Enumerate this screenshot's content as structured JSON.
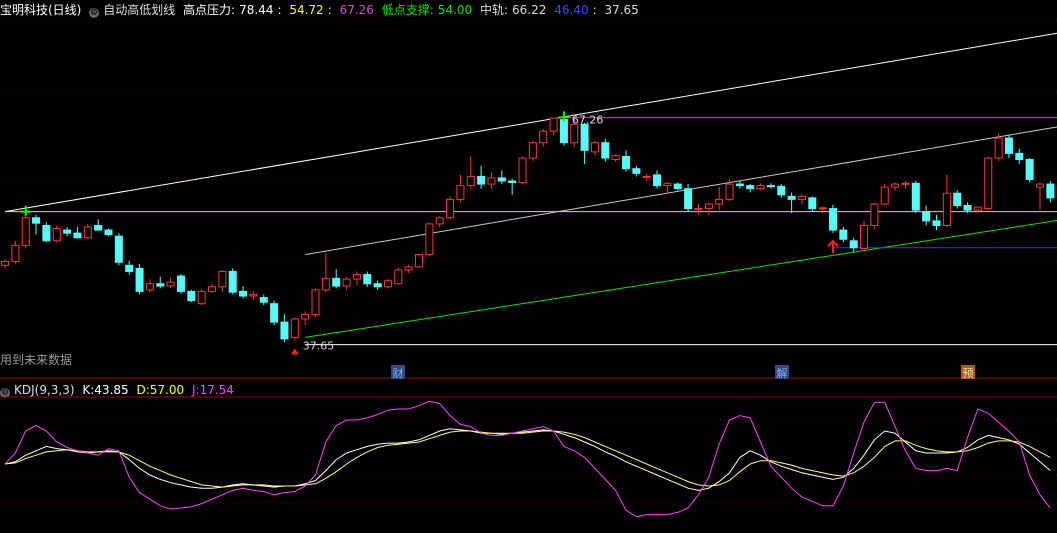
{
  "header": {
    "stock": "宝明科技(日线)",
    "indicator": "自动高低划线",
    "high_label": "高点压力:",
    "high_vals": [
      "78.44",
      "54.72"
    ],
    "high_val3": "67.26",
    "low_label": "低点支撑:",
    "low_val": "54.00",
    "mid_label": "中轨:",
    "mid_val": "66.22",
    "blue_val": "46.40",
    "last_val": "37.65",
    "future_note": "用到未来数据"
  },
  "kdj": {
    "name": "KDJ(9,3,3)",
    "k_label": "K:",
    "k_val": "43.85",
    "d_label": "D:",
    "d_val": "57.00",
    "j_label": "J:",
    "j_val": "17.54"
  },
  "events": [
    "财",
    "解",
    "预"
  ],
  "colors": {
    "up": "#ff3232",
    "down": "#54fcfc",
    "upper": "#ffffff",
    "middle": "#c8c8c8",
    "support": "#00e600",
    "resistance": "#e0e040",
    "purple": "#c040c0",
    "blue": "#2040ff",
    "k": "#ffffff",
    "d": "#ffff60",
    "j": "#ff40ff"
  },
  "chart_data": [
    {
      "type": "candlestick",
      "ylim": [
        35,
        80
      ],
      "price_labels": [
        "67.26",
        "37.65"
      ],
      "candles": [
        [
          48.0,
          48.8,
          47.6,
          48.5
        ],
        [
          48.5,
          51.2,
          48.2,
          50.6
        ],
        [
          50.6,
          55.0,
          50.2,
          54.2
        ],
        [
          54.2,
          54.6,
          52.0,
          53.5
        ],
        [
          53.2,
          53.6,
          51.0,
          51.2
        ],
        [
          51.2,
          53.2,
          51.0,
          52.8
        ],
        [
          52.6,
          53.0,
          51.8,
          52.2
        ],
        [
          52.2,
          53.0,
          51.5,
          51.6
        ],
        [
          51.6,
          53.4,
          51.4,
          53.0
        ],
        [
          53.2,
          54.0,
          52.6,
          52.6
        ],
        [
          52.6,
          52.8,
          51.8,
          52.0
        ],
        [
          51.8,
          52.2,
          48.0,
          48.4
        ],
        [
          48.0,
          48.6,
          46.8,
          47.2
        ],
        [
          47.6,
          48.2,
          44.2,
          44.6
        ],
        [
          44.8,
          46.2,
          44.5,
          45.6
        ],
        [
          45.6,
          46.5,
          45.0,
          45.3
        ],
        [
          45.3,
          46.4,
          45.0,
          45.8
        ],
        [
          46.6,
          46.9,
          44.3,
          44.6
        ],
        [
          44.6,
          44.8,
          43.2,
          43.4
        ],
        [
          43.0,
          44.9,
          42.8,
          44.6
        ],
        [
          44.6,
          45.6,
          44.4,
          45.2
        ],
        [
          45.2,
          47.4,
          44.5,
          47.2
        ],
        [
          47.2,
          47.6,
          44.2,
          44.5
        ],
        [
          44.6,
          45.3,
          43.7,
          44.0
        ],
        [
          44.0,
          44.6,
          43.5,
          44.2
        ],
        [
          43.8,
          44.2,
          42.8,
          43.2
        ],
        [
          43.0,
          43.4,
          40.2,
          40.6
        ],
        [
          40.6,
          41.6,
          38.0,
          38.4
        ],
        [
          38.6,
          41.2,
          38.2,
          41.0
        ],
        [
          41.0,
          42.0,
          40.2,
          41.6
        ],
        [
          41.6,
          45.0,
          41.2,
          44.8
        ],
        [
          44.8,
          49.6,
          44.5,
          46.3
        ],
        [
          46.3,
          47.5,
          45.0,
          45.3
        ],
        [
          45.3,
          46.5,
          44.8,
          46.2
        ],
        [
          46.2,
          47.2,
          45.4,
          46.8
        ],
        [
          46.8,
          47.2,
          45.2,
          45.6
        ],
        [
          45.6,
          46.0,
          44.8,
          45.2
        ],
        [
          45.2,
          46.2,
          45.0,
          46.0
        ],
        [
          45.6,
          47.7,
          45.5,
          47.4
        ],
        [
          47.4,
          48.1,
          47.0,
          47.8
        ],
        [
          47.8,
          49.5,
          47.6,
          49.4
        ],
        [
          49.4,
          53.6,
          49.2,
          53.4
        ],
        [
          53.4,
          54.4,
          53.0,
          54.2
        ],
        [
          54.2,
          57.0,
          54.0,
          56.6
        ],
        [
          56.6,
          59.8,
          56.2,
          58.4
        ],
        [
          58.4,
          62.2,
          58.0,
          59.6
        ],
        [
          59.6,
          61.0,
          58.0,
          58.6
        ],
        [
          58.6,
          60.2,
          58.0,
          59.4
        ],
        [
          59.4,
          60.4,
          58.6,
          59.0
        ],
        [
          59.0,
          59.3,
          57.2,
          58.8
        ],
        [
          58.8,
          62.2,
          58.6,
          62.0
        ],
        [
          62.0,
          64.2,
          61.6,
          64.0
        ],
        [
          64.0,
          65.8,
          63.5,
          65.5
        ],
        [
          65.5,
          67.26,
          65.0,
          67.2
        ],
        [
          67.0,
          67.3,
          63.6,
          64.0
        ],
        [
          64.0,
          67.0,
          63.4,
          66.4
        ],
        [
          66.4,
          66.6,
          61.2,
          63.0
        ],
        [
          62.8,
          64.2,
          62.3,
          64.0
        ],
        [
          64.0,
          64.5,
          61.5,
          62.0
        ],
        [
          61.8,
          62.5,
          61.5,
          62.3
        ],
        [
          62.2,
          63.0,
          60.2,
          60.6
        ],
        [
          60.6,
          61.0,
          59.6,
          60.0
        ],
        [
          59.6,
          60.0,
          59.0,
          59.6
        ],
        [
          59.8,
          60.4,
          58.0,
          58.4
        ],
        [
          58.4,
          58.9,
          57.4,
          58.7
        ],
        [
          58.6,
          58.8,
          57.8,
          58.0
        ],
        [
          58.0,
          58.6,
          55.0,
          55.4
        ],
        [
          55.4,
          56.0,
          54.6,
          55.4
        ],
        [
          55.4,
          56.2,
          54.5,
          56.0
        ],
        [
          56.0,
          58.2,
          55.2,
          56.6
        ],
        [
          56.6,
          59.2,
          56.4,
          58.6
        ],
        [
          58.6,
          59.0,
          58.0,
          58.4
        ],
        [
          58.4,
          58.6,
          57.5,
          58.0
        ],
        [
          58.0,
          58.7,
          57.8,
          58.4
        ],
        [
          58.4,
          58.7,
          58.0,
          58.3
        ],
        [
          58.3,
          58.6,
          56.8,
          57.2
        ],
        [
          57.0,
          57.5,
          54.8,
          56.6
        ],
        [
          56.6,
          57.3,
          56.0,
          57.0
        ],
        [
          56.8,
          57.0,
          55.0,
          55.4
        ],
        [
          55.4,
          55.7,
          54.8,
          55.5
        ],
        [
          55.4,
          55.9,
          52.2,
          52.6
        ],
        [
          52.6,
          53.0,
          51.0,
          51.4
        ],
        [
          51.2,
          51.6,
          49.8,
          50.3
        ],
        [
          50.2,
          53.8,
          50.0,
          53.2
        ],
        [
          53.2,
          56.2,
          52.8,
          56.0
        ],
        [
          56.0,
          58.6,
          55.8,
          58.2
        ],
        [
          58.2,
          58.8,
          57.8,
          58.6
        ],
        [
          58.6,
          59.0,
          58.0,
          58.7
        ],
        [
          58.7,
          59.0,
          54.8,
          55.2
        ],
        [
          55.0,
          55.8,
          53.2,
          53.8
        ],
        [
          53.8,
          54.6,
          52.6,
          53.2
        ],
        [
          53.2,
          59.8,
          53.0,
          57.4
        ],
        [
          57.4,
          57.8,
          55.4,
          55.8
        ],
        [
          55.8,
          56.2,
          54.8,
          55.2
        ],
        [
          55.2,
          55.7,
          54.8,
          55.6
        ],
        [
          55.4,
          62.2,
          55.2,
          62.0
        ],
        [
          62.0,
          65.2,
          61.6,
          64.6
        ],
        [
          64.6,
          65.0,
          62.0,
          62.6
        ],
        [
          62.6,
          63.2,
          61.2,
          61.8
        ],
        [
          61.8,
          62.0,
          58.8,
          59.2
        ],
        [
          58.2,
          58.8,
          55.3,
          58.6
        ],
        [
          58.6,
          59.0,
          56.2,
          56.8
        ]
      ],
      "lines": {
        "upper_channel": [
          [
            0,
            55.0
          ],
          [
            102,
            78.44
          ]
        ],
        "middle_channel": [
          [
            29,
            49.4
          ],
          [
            102,
            66.22
          ]
        ],
        "support": [
          [
            29,
            38.6
          ],
          [
            102,
            54.0
          ]
        ],
        "horizontal_resistance": [
          [
            0,
            55.0
          ],
          [
            102,
            55.0
          ]
        ],
        "horizontal_bottom": [
          [
            29,
            37.65
          ],
          [
            102,
            37.65
          ]
        ],
        "high_mark": [
          [
            54,
            67.26
          ],
          [
            102,
            67.26
          ]
        ],
        "low_mark": [
          [
            80,
            50.3
          ],
          [
            102,
            50.3
          ]
        ]
      },
      "markers": {
        "top_high": 54,
        "left_high": 2,
        "bottom_low": 28,
        "right_low": 80
      }
    },
    {
      "type": "line",
      "ylim": [
        -10,
        110
      ],
      "series": [
        {
          "name": "K",
          "values": [
            50,
            52,
            58,
            62,
            66,
            64,
            63,
            61,
            60,
            61,
            62,
            61,
            54,
            46,
            40,
            36,
            33,
            31,
            29,
            28,
            28,
            29,
            31,
            32,
            31,
            30,
            29,
            30,
            30,
            32,
            35,
            44,
            54,
            60,
            63,
            66,
            68,
            69,
            69,
            70,
            72,
            76,
            80,
            82,
            81,
            80,
            78,
            78,
            77,
            78,
            79,
            80,
            81,
            80,
            77,
            74,
            70,
            66,
            61,
            57,
            52,
            48,
            44,
            40,
            36,
            32,
            28,
            26,
            28,
            34,
            42,
            56,
            62,
            58,
            52,
            48,
            45,
            42,
            40,
            38,
            36,
            38,
            46,
            58,
            72,
            80,
            78,
            70,
            62,
            60,
            60,
            60,
            61,
            65,
            72,
            76,
            74,
            72,
            68,
            60,
            52,
            44
          ]
        },
        {
          "name": "D",
          "values": [
            50,
            51,
            55,
            58,
            61,
            62,
            63,
            62,
            61,
            61,
            61,
            61,
            58,
            53,
            48,
            44,
            40,
            37,
            34,
            31,
            30,
            29,
            30,
            31,
            31,
            31,
            30,
            30,
            30,
            31,
            32,
            37,
            43,
            50,
            56,
            61,
            65,
            67,
            68,
            69,
            70,
            73,
            76,
            79,
            80,
            80,
            79,
            78,
            78,
            78,
            78,
            79,
            80,
            80,
            79,
            77,
            74,
            70,
            66,
            62,
            58,
            54,
            50,
            46,
            42,
            38,
            34,
            31,
            30,
            31,
            35,
            43,
            50,
            53,
            53,
            51,
            49,
            46,
            44,
            42,
            40,
            39,
            42,
            48,
            56,
            66,
            71,
            71,
            67,
            64,
            62,
            61,
            61,
            62,
            65,
            69,
            71,
            71,
            70,
            66,
            61,
            56
          ]
        },
        {
          "name": "J",
          "values": [
            50,
            60,
            80,
            85,
            80,
            70,
            65,
            62,
            60,
            58,
            64,
            62,
            38,
            24,
            18,
            12,
            9,
            10,
            11,
            14,
            18,
            22,
            26,
            28,
            26,
            25,
            22,
            24,
            25,
            30,
            40,
            70,
            85,
            90,
            90,
            92,
            95,
            99,
            100,
            100,
            103,
            107,
            105,
            94,
            86,
            84,
            78,
            76,
            76,
            78,
            80,
            82,
            84,
            80,
            66,
            62,
            56,
            46,
            36,
            26,
            8,
            2,
            4,
            4,
            4,
            6,
            10,
            22,
            38,
            68,
            90,
            94,
            92,
            70,
            48,
            38,
            28,
            20,
            16,
            12,
            12,
            30,
            60,
            88,
            106,
            106,
            84,
            62,
            46,
            44,
            44,
            46,
            44,
            74,
            100,
            96,
            88,
            80,
            70,
            40,
            22,
            10
          ]
        }
      ]
    }
  ]
}
